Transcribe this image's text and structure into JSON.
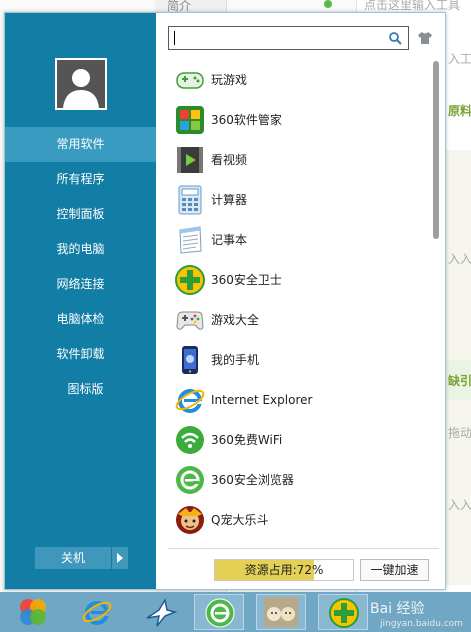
{
  "background": {
    "texts": [
      "简介",
      "点击这里输入工具",
      "入工具",
      "原料",
      "入入步",
      "缺引用",
      "拖动",
      "入入步"
    ]
  },
  "sidebar": {
    "items": [
      {
        "label": "常用软件",
        "active": true
      },
      {
        "label": "所有程序",
        "active": false
      },
      {
        "label": "控制面板",
        "active": false
      },
      {
        "label": "我的电脑",
        "active": false
      },
      {
        "label": "网络连接",
        "active": false
      },
      {
        "label": "电脑体检",
        "active": false
      },
      {
        "label": "软件卸载",
        "active": false
      },
      {
        "label": "图标版",
        "active": false
      }
    ],
    "shutdown_label": "关机"
  },
  "search": {
    "value": "",
    "placeholder": ""
  },
  "apps": [
    {
      "label": "玩游戏",
      "icon": "gamepad-icon"
    },
    {
      "label": "360软件管家",
      "icon": "software-manager-icon"
    },
    {
      "label": "看视频",
      "icon": "video-icon"
    },
    {
      "label": "计算器",
      "icon": "calculator-icon"
    },
    {
      "label": "记事本",
      "icon": "notepad-icon"
    },
    {
      "label": "360安全卫士",
      "icon": "360-safe-icon"
    },
    {
      "label": "游戏大全",
      "icon": "game-collection-icon"
    },
    {
      "label": "我的手机",
      "icon": "phone-icon"
    },
    {
      "label": "Internet Explorer",
      "icon": "ie-icon"
    },
    {
      "label": "360免费WiFi",
      "icon": "wifi-icon"
    },
    {
      "label": "360安全浏览器",
      "icon": "360-browser-icon"
    },
    {
      "label": "Q宠大乐斗",
      "icon": "q-pet-icon"
    }
  ],
  "footer": {
    "usage_label": "资源占用:72%",
    "usage_percent": 72,
    "accelerate_label": "一键加速"
  },
  "taskbar": {
    "items": [
      "windows-start-icon",
      "ie-icon",
      "bird-app-icon",
      "360-browser-icon",
      "photo-thumbnail-icon",
      "360-safe-icon"
    ],
    "watermark": "Bai 经验",
    "watermark_sub": "jingyan.baidu.com"
  },
  "colors": {
    "sidebar": "#127ea5",
    "sidebar_active": "#3a9bc0",
    "usage_fill": "#e4d055",
    "taskbar": "#6fa7c5"
  }
}
